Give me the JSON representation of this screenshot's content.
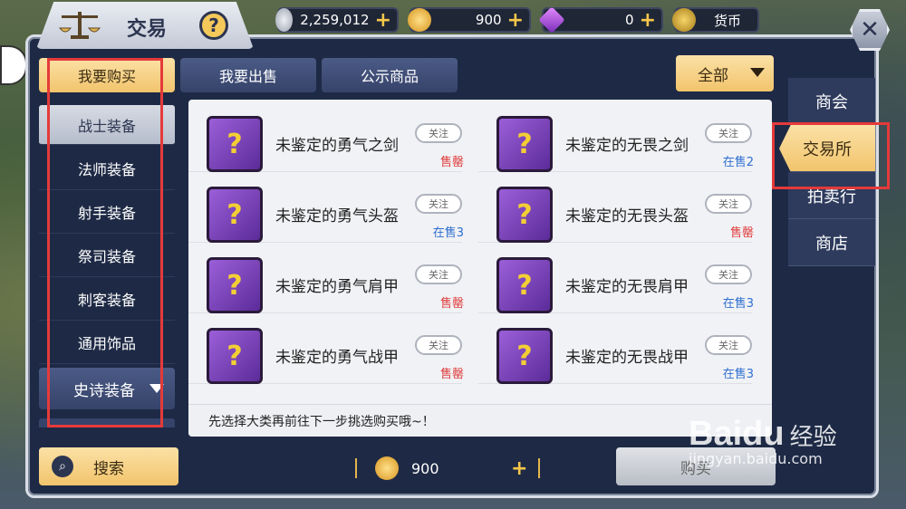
{
  "header": {
    "title": "交易",
    "help_label": "?",
    "currencies": [
      {
        "icon": "silver-coin-icon",
        "value": "2,259,012",
        "color": "#c7ccd6"
      },
      {
        "icon": "gold-coin-icon",
        "value": "900",
        "color": "#f2b632"
      },
      {
        "icon": "purple-gem-icon",
        "value": "0",
        "color": "#b55ae0"
      },
      {
        "icon": "currency-coin-icon",
        "value": "货币",
        "color": "#e6b838"
      }
    ],
    "close_label": "✕"
  },
  "top_tabs": [
    "我要购买",
    "我要出售",
    "公示商品"
  ],
  "filter_dropdown": "全部",
  "categories": [
    "战士装备",
    "法师装备",
    "射手装备",
    "祭司装备",
    "刺客装备",
    "通用饰品"
  ],
  "epic_category": "史诗装备",
  "items": [
    {
      "name": "未鉴定的勇气之剑",
      "follow": "关注",
      "status": "售罄",
      "status_type": "sold"
    },
    {
      "name": "未鉴定的无畏之剑",
      "follow": "关注",
      "status": "在售2",
      "status_type": "onsale"
    },
    {
      "name": "未鉴定的勇气头盔",
      "follow": "关注",
      "status": "在售3",
      "status_type": "onsale"
    },
    {
      "name": "未鉴定的无畏头盔",
      "follow": "关注",
      "status": "售罄",
      "status_type": "sold"
    },
    {
      "name": "未鉴定的勇气肩甲",
      "follow": "关注",
      "status": "售罄",
      "status_type": "sold"
    },
    {
      "name": "未鉴定的无畏肩甲",
      "follow": "关注",
      "status": "在售3",
      "status_type": "onsale"
    },
    {
      "name": "未鉴定的勇气战甲",
      "follow": "关注",
      "status": "售罄",
      "status_type": "sold"
    },
    {
      "name": "未鉴定的无畏战甲",
      "follow": "关注",
      "status": "在售3",
      "status_type": "onsale"
    }
  ],
  "hint": "先选择大类再前往下一步挑选购买哦~！",
  "side_tabs": [
    "商会",
    "交易所",
    "拍卖行",
    "商店"
  ],
  "bottom": {
    "search_label": "搜索",
    "price_value": "900",
    "buy_label": "购买"
  },
  "watermark": {
    "logo": "Bai",
    "logo2": "du",
    "cn": "经验",
    "url": "jingyan.baidu.com"
  }
}
